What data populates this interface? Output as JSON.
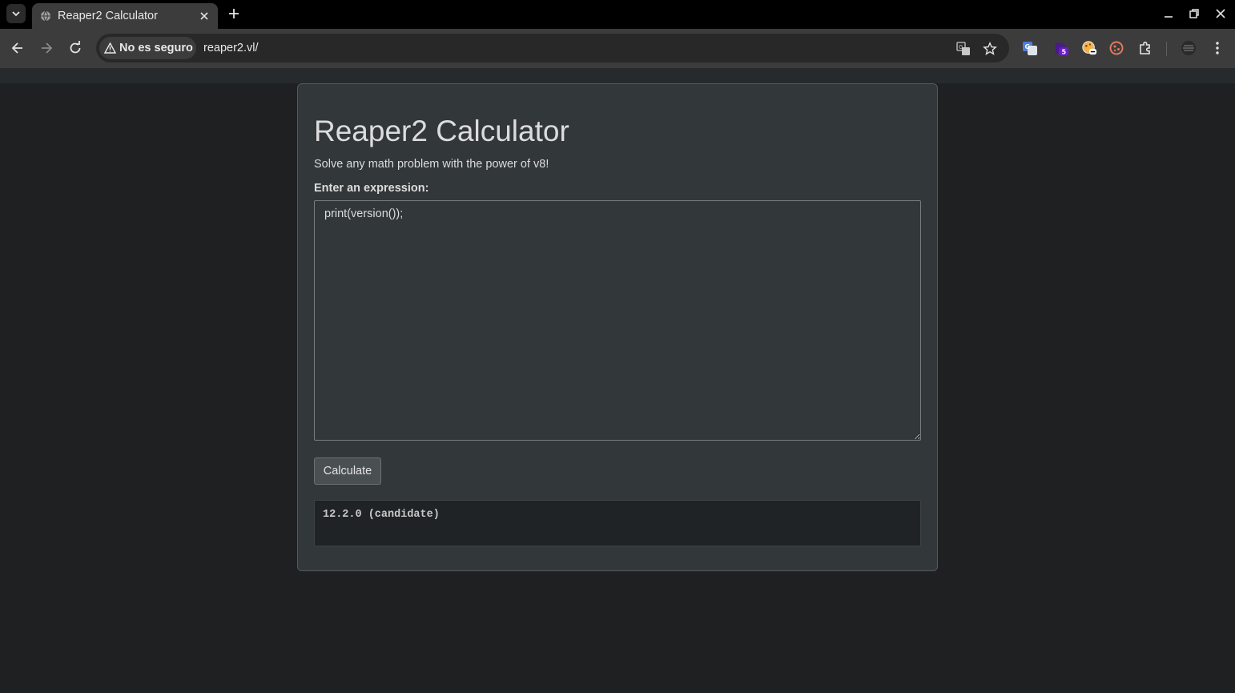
{
  "browser": {
    "tab_title": "Reaper2 Calculator",
    "security_label": "No es seguro",
    "url": "reaper2.vl/",
    "extension_badge_count": "5"
  },
  "page": {
    "title": "Reaper2 Calculator",
    "subtitle": "Solve any math problem with the power of v8!",
    "expression_label": "Enter an expression:",
    "expression_value": "print(version());",
    "calculate_label": "Calculate",
    "result_output": "12.2.0 (candidate)"
  },
  "colors": {
    "page_background": "#1e2022",
    "card_background": "#323739",
    "result_background": "#1f2325",
    "extension_purple": "#6a1fc2",
    "translate_blue": "#4d7de0"
  }
}
